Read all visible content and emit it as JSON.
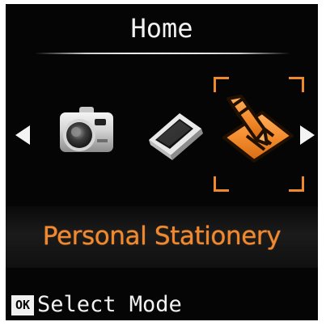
{
  "header": {
    "title": "Home"
  },
  "carousel": {
    "left_arrow_icon": "left-arrow-icon",
    "right_arrow_icon": "right-arrow-icon",
    "items": [
      {
        "icon": "camera-icon",
        "selected": false
      },
      {
        "icon": "scanner-icon",
        "selected": false
      },
      {
        "icon": "personal-stationery-icon",
        "selected": true
      }
    ],
    "selected_label": "Personal Stationery"
  },
  "footer": {
    "ok_label": "OK",
    "action_text": "Select Mode"
  },
  "colors": {
    "accent": "#f0892f",
    "background": "#050505",
    "text": "#f2f2f2"
  }
}
